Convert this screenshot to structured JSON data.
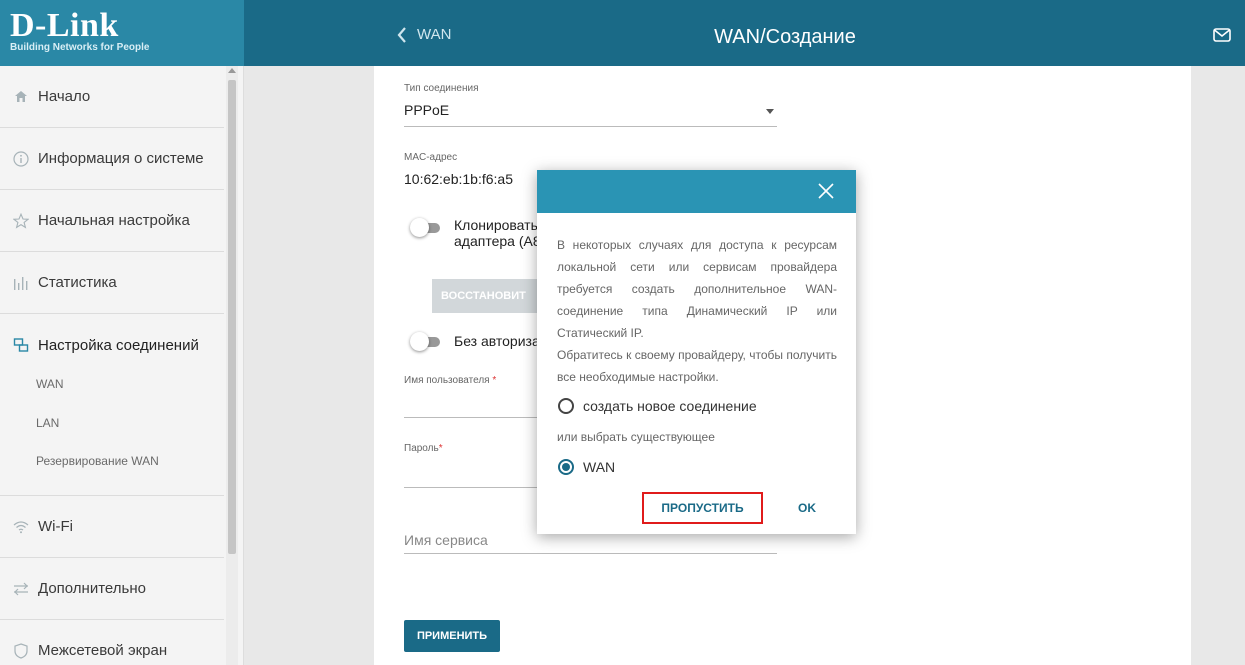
{
  "header": {
    "logo_main": "D-Link",
    "logo_sub": "Building Networks for People",
    "back_label": "WAN",
    "title": "WAN/Создание",
    "mail_icon": "mail-icon"
  },
  "sidebar": {
    "items": [
      {
        "label": "Начало",
        "icon": "home-icon"
      },
      {
        "label": "Информация о системе",
        "icon": "info-icon"
      },
      {
        "label": "Начальная настройка",
        "icon": "star-icon"
      },
      {
        "label": "Статистика",
        "icon": "bar-chart-icon"
      },
      {
        "label": "Настройка соединений",
        "icon": "connections-icon"
      },
      {
        "label": "Wi-Fi",
        "icon": "wifi-icon"
      },
      {
        "label": "Дополнительно",
        "icon": "sliders-icon"
      },
      {
        "label": "Межсетевой экран",
        "icon": "shield-icon"
      }
    ],
    "subitems": [
      "WAN",
      "LAN",
      "Резервирование WAN"
    ]
  },
  "form": {
    "conn_type_label": "Тип соединения",
    "conn_type_value": "PPPoE",
    "mac_label": "MAC-адрес",
    "mac_value": "10:62:eb:1b:f6:a5",
    "clone_label_1": "Клонировать",
    "clone_label_2": "адаптера (А8",
    "restore_button": "ВОССТАНОВИТ",
    "no_auth_label": "Без авториза",
    "username_label": "Имя пользователя",
    "username_required": "*",
    "password_label": "Пароль",
    "password_required": "*",
    "service_placeholder": "Имя сервиса",
    "apply_button": "ПРИМЕНИТЬ"
  },
  "dialog": {
    "message_1": "В некоторых случаях для доступа к ресурсам локальной сети или сервисам провайдера требуется создать дополнительное WAN-соединение типа Динамический IP или Статический IP.",
    "message_2": "Обратитесь к своему провайдеру, чтобы получить все необходимые настройки.",
    "option_new": "создать новое соединение",
    "or_text": "или выбрать существующее",
    "option_wan": "WAN",
    "skip_button": "ПРОПУСТИТЬ",
    "ok_button": "OK"
  },
  "colors": {
    "header": "#1a6a87",
    "logo_bg": "#2a88a6",
    "dialog_head": "#2a94b4",
    "highlight": "#e01b1b"
  }
}
